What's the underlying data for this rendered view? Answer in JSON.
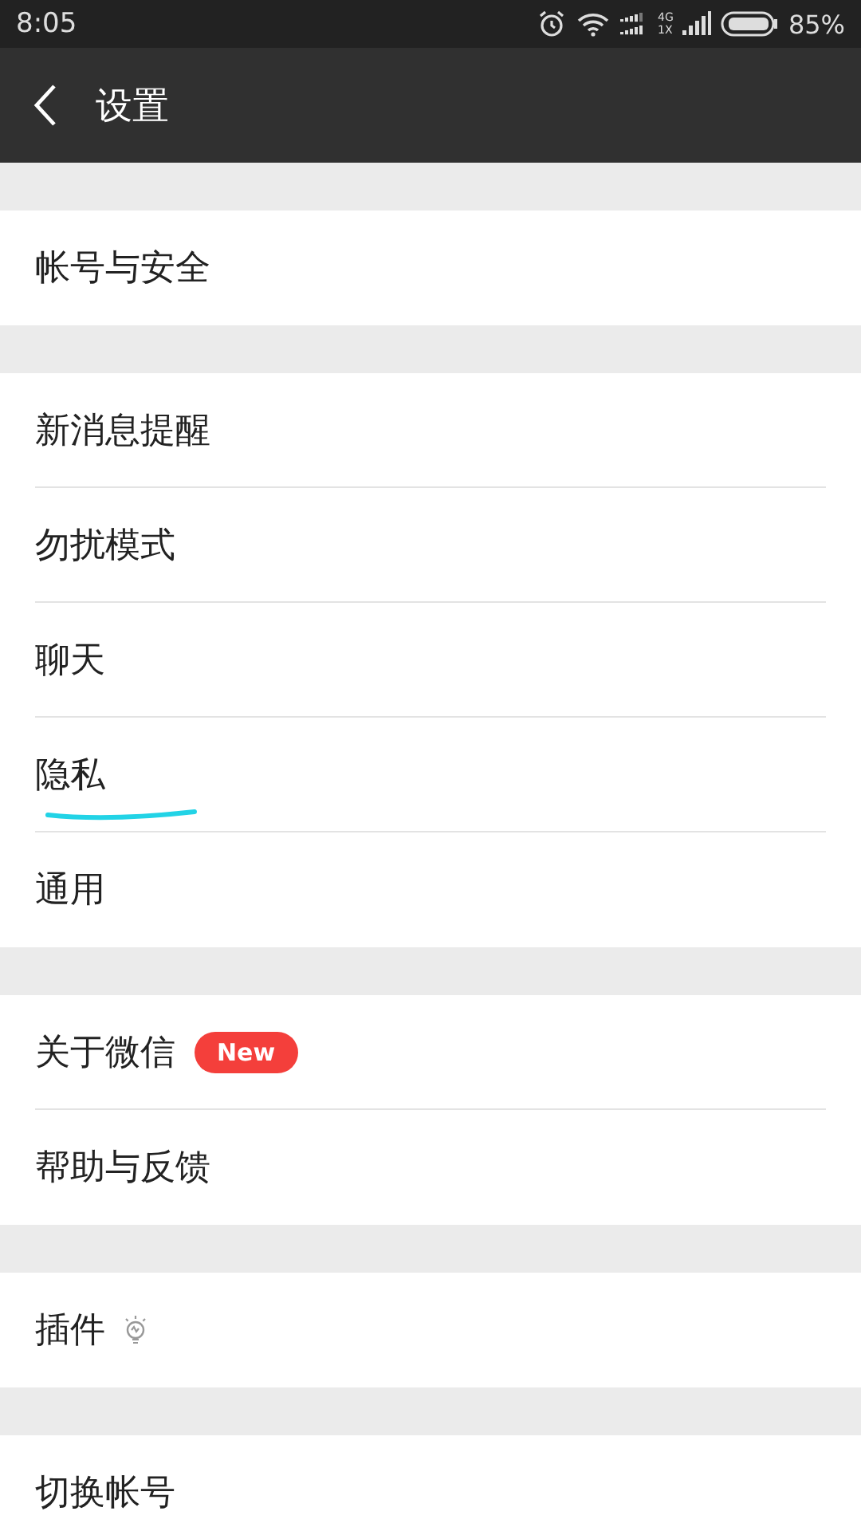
{
  "status_bar": {
    "time": "8:05",
    "network_top": "4G",
    "network_bottom": "1X",
    "battery": "85%"
  },
  "header": {
    "back": true,
    "title": "设置"
  },
  "groups": [
    {
      "items": [
        {
          "label": "帐号与安全",
          "kind": "plain",
          "underlined": false
        }
      ]
    },
    {
      "items": [
        {
          "label": "新消息提醒",
          "kind": "plain",
          "underlined": false
        },
        {
          "label": "勿扰模式",
          "kind": "plain",
          "underlined": false
        },
        {
          "label": "聊天",
          "kind": "plain",
          "underlined": false
        },
        {
          "label": "隐私",
          "kind": "plain",
          "underlined": true
        },
        {
          "label": "通用",
          "kind": "plain",
          "underlined": false
        }
      ]
    },
    {
      "items": [
        {
          "label": "关于微信",
          "kind": "badge",
          "badge": "New",
          "underlined": false
        },
        {
          "label": "帮助与反馈",
          "kind": "plain",
          "underlined": false
        }
      ]
    },
    {
      "items": [
        {
          "label": "插件",
          "kind": "bulb",
          "underlined": false
        }
      ]
    },
    {
      "items": [
        {
          "label": "切换帐号",
          "kind": "plain",
          "underlined": false
        }
      ]
    }
  ]
}
